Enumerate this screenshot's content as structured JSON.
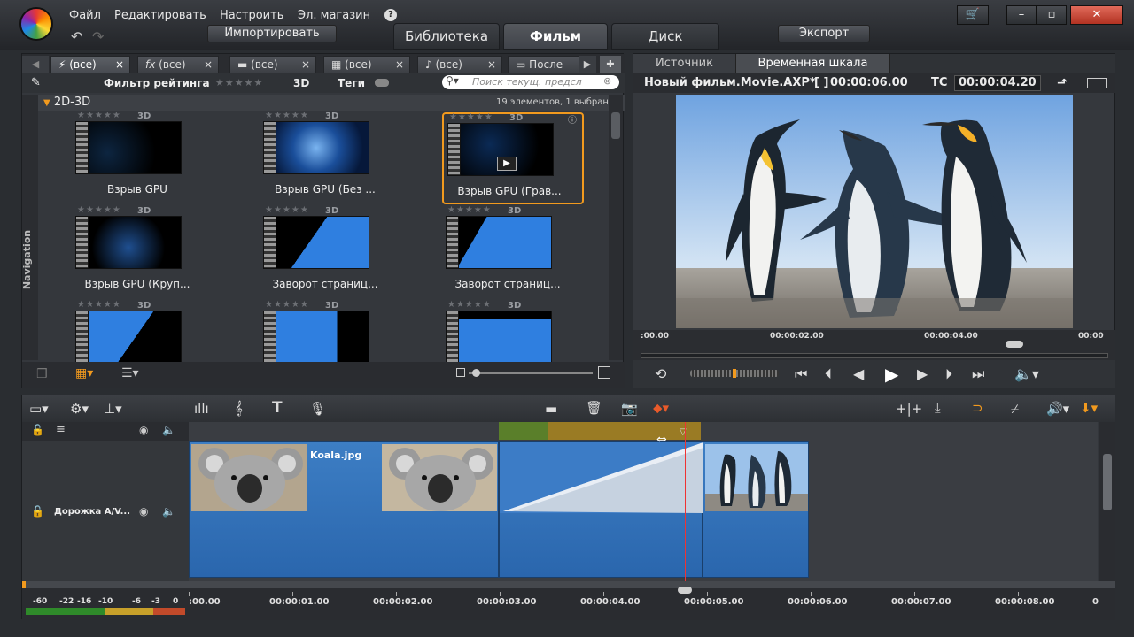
{
  "menu": {
    "file": "Файл",
    "edit": "Редактировать",
    "setup": "Настроить",
    "store": "Эл. магазин",
    "help_icon": "?"
  },
  "toolbar": {
    "import": "Импортировать",
    "export": "Экспорт"
  },
  "main_tabs": [
    "Библиотека",
    "Фильм",
    "Диск"
  ],
  "main_tabs_active": "Фильм",
  "window_controls": {
    "cart": "🛒",
    "minimize": "–",
    "maximize": "▫",
    "close": "✕"
  },
  "library": {
    "tabs": [
      {
        "icon": "⚡",
        "label": "(все)"
      },
      {
        "icon": "fx",
        "label": "(все)"
      },
      {
        "icon": "▬",
        "label": "(все)"
      },
      {
        "icon": "▦",
        "label": "(все)"
      },
      {
        "icon": "♪",
        "label": "(все)"
      },
      {
        "icon": "▭",
        "label": "После"
      }
    ],
    "filter_label": "Фильтр рейтинга",
    "filter_stars": "★★★★★",
    "tag_3d": "3D",
    "tags_label": "Теги",
    "search_placeholder": "Поиск текущ. предсл",
    "group_name": "2D-3D",
    "group_count": "19 элементов, 1 выбрано",
    "nav_label": "Navigation",
    "items": [
      {
        "caption": "Взрыв GPU",
        "badge": "3D",
        "stars": "★★★★★"
      },
      {
        "caption": "Взрыв GPU (Без ...",
        "badge": "3D",
        "stars": "★★★★★"
      },
      {
        "caption": "Взрыв GPU (Грав...",
        "badge": "3D",
        "stars": "★★★★★"
      },
      {
        "caption": "Взрыв GPU (Круп...",
        "badge": "3D",
        "stars": "★★★★★"
      },
      {
        "caption": "Заворот страниц...",
        "badge": "3D",
        "stars": "★★★★★"
      },
      {
        "caption": "Заворот страниц...",
        "badge": "3D",
        "stars": "★★★★★"
      },
      {
        "caption": "",
        "badge": "3D",
        "stars": "★★★★★"
      },
      {
        "caption": "",
        "badge": "3D",
        "stars": "★★★★★"
      },
      {
        "caption": "",
        "badge": "3D",
        "stars": "★★★★★"
      }
    ],
    "selected_index": 2
  },
  "preview": {
    "tabs": [
      "Источник",
      "Временная шкала"
    ],
    "active_tab": "Временная шкала",
    "title": "Новый фильм.Movie.AXP*",
    "duration_icon": "[ ]",
    "duration": "00:00:06.00",
    "tc_label": "TC",
    "timecode": "00:00:04.20",
    "ruler": [
      ":00.00",
      "00:00:02.00",
      "00:00:04.00",
      "00:00"
    ]
  },
  "timeline": {
    "track_name": "Дорожка A/V...",
    "clip_title": "Koala.jpg",
    "ruler": [
      ":00.00",
      "00:00:01.00",
      "00:00:02.00",
      "00:00:03.00",
      "00:00:04.00",
      "00:00:05.00",
      "00:00:06.00",
      "00:00:07.00",
      "00:00:08.00",
      "0"
    ],
    "meter": [
      "-60",
      "-22",
      "-16",
      "-10",
      "-6",
      "-3",
      "0"
    ]
  }
}
